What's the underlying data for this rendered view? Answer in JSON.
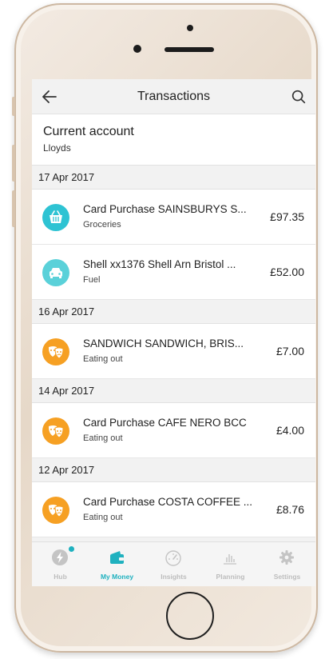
{
  "header": {
    "title": "Transactions"
  },
  "account": {
    "name": "Current account",
    "bank": "Lloyds"
  },
  "groups": [
    {
      "date": "17 Apr 2017",
      "items": [
        {
          "title": "Card Purchase SAINSBURYS S...",
          "category": "Groceries",
          "amount": "£97.35",
          "icon": "basket-icon",
          "color": "#2ec3d3"
        },
        {
          "title": "Shell xx1376 Shell Arn Bristol ...",
          "category": "Fuel",
          "amount": "£52.00",
          "icon": "car-icon",
          "color": "#5ad1d9"
        }
      ]
    },
    {
      "date": "16 Apr 2017",
      "items": [
        {
          "title": "SANDWICH SANDWICH, BRIS...",
          "category": "Eating out",
          "amount": "£7.00",
          "icon": "theatre-masks-icon",
          "color": "#f6a023"
        }
      ]
    },
    {
      "date": "14 Apr 2017",
      "items": [
        {
          "title": "Card Purchase CAFE NERO BCC",
          "category": "Eating out",
          "amount": "£4.00",
          "icon": "theatre-masks-icon",
          "color": "#f6a023"
        }
      ]
    },
    {
      "date": "12 Apr 2017",
      "items": [
        {
          "title": "Card Purchase COSTA COFFEE ...",
          "category": "Eating out",
          "amount": "£8.76",
          "icon": "theatre-masks-icon",
          "color": "#f6a023"
        }
      ]
    }
  ],
  "tabs": [
    {
      "label": "Hub",
      "icon": "lightning-icon",
      "active": false
    },
    {
      "label": "My Money",
      "icon": "wallet-icon",
      "active": true
    },
    {
      "label": "Insights",
      "icon": "gauge-icon",
      "active": false
    },
    {
      "label": "Planning",
      "icon": "bar-chart-icon",
      "active": false
    },
    {
      "label": "Settings",
      "icon": "gear-icon",
      "active": false
    }
  ],
  "colors": {
    "accent": "#1fb1bf",
    "groceries": "#2ec3d3",
    "fuel": "#5ad1d9",
    "eating_out": "#f6a023"
  }
}
